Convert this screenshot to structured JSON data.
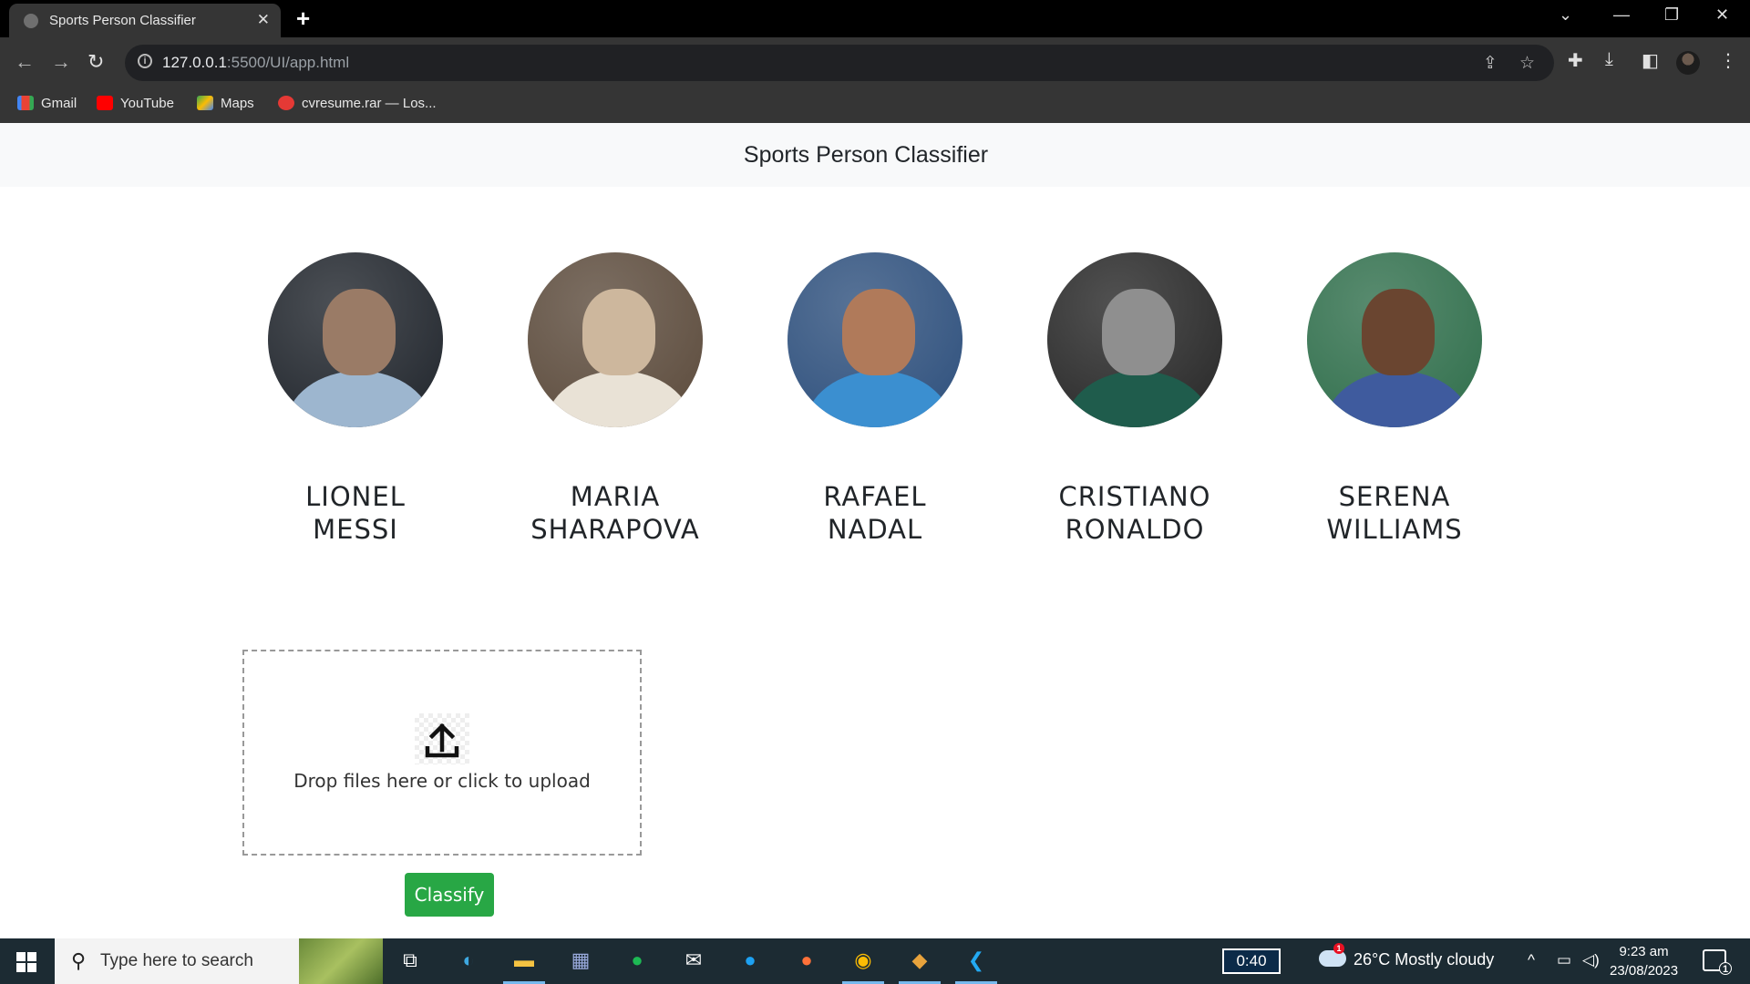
{
  "browser": {
    "tab_title": "Sports Person Classifier",
    "url_host": "127.0.0.1",
    "url_path": ":5500/UI/app.html",
    "bookmarks": [
      {
        "label": "Gmail",
        "icon": "gmail-icon",
        "color": "#ea4335"
      },
      {
        "label": "YouTube",
        "icon": "youtube-icon",
        "color": "#ff0000"
      },
      {
        "label": "Maps",
        "icon": "maps-icon",
        "color": "#34a853"
      },
      {
        "label": "cvresume.rar — Los...",
        "icon": "bookmark-red-icon",
        "color": "#e53935"
      }
    ]
  },
  "page": {
    "brand": "Sports Person Classifier",
    "players": [
      {
        "first": "LIONEL",
        "last": "MESSI",
        "photo_bg": "#1f242b",
        "shirt": "#9db6cf",
        "skin": "#9a7b66"
      },
      {
        "first": "MARIA",
        "last": "SHARAPOVA",
        "photo_bg": "#5b4a3b",
        "shirt": "#e9e2d6",
        "skin": "#cdb79d"
      },
      {
        "first": "RAFAEL",
        "last": "NADAL",
        "photo_bg": "#2d4f7c",
        "shirt": "#3b8fd0",
        "skin": "#b07a5a"
      },
      {
        "first": "CRISTIANO",
        "last": "RONALDO",
        "photo_bg": "#262626",
        "shirt": "#1f5c4c",
        "skin": "#8f8f8f"
      },
      {
        "first": "SERENA",
        "last": "WILLIAMS",
        "photo_bg": "#2f6e4b",
        "shirt": "#3f5b9e",
        "skin": "#6a4530"
      }
    ],
    "dropzone_message": "Drop files here or click to upload",
    "classify_label": "Classify"
  },
  "taskbar": {
    "search_placeholder": "Type here to search",
    "timer": "0:40",
    "weather": "26°C  Mostly cloudy",
    "weather_badge": "1",
    "time": "9:23 am",
    "date": "23/08/2023",
    "notification_count": "1"
  }
}
